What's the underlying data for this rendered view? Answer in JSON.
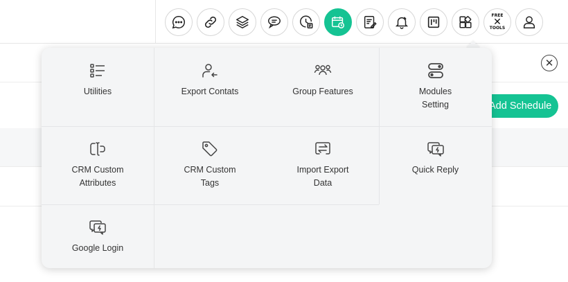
{
  "toolbar": {
    "icons": [
      "chat-icon",
      "link-icon",
      "layers-icon",
      "speech-bubble-icon",
      "clock-note-icon",
      "calendar-clock-icon",
      "note-edit-icon",
      "bell-icon",
      "kanban-icon",
      "widgets-icon",
      "free-tools-icon",
      "user-icon"
    ],
    "active": "calendar-clock-icon",
    "free_tools_top": "FREE",
    "free_tools_bottom": "TOOLS"
  },
  "page": {
    "add_schedule_label": "Add Schedule",
    "close_symbol": "✕"
  },
  "menu": {
    "items": [
      {
        "label": "Utilities",
        "icon": "list-icon"
      },
      {
        "label": "Export Contats",
        "icon": "user-export-icon"
      },
      {
        "label": "Group Features",
        "icon": "group-icon"
      },
      {
        "label": "Modules\nSetting",
        "icon": "toggle-icon"
      },
      {
        "label": "CRM Custom\nAttributes",
        "icon": "text-cursor-icon"
      },
      {
        "label": "CRM Custom\nTags",
        "icon": "tag-icon"
      },
      {
        "label": "Import Export\nData",
        "icon": "transfer-icon"
      },
      {
        "label": "Quick Reply",
        "icon": "quick-reply-icon"
      },
      {
        "label": "Google Login",
        "icon": "chat-lightning-icon"
      }
    ]
  },
  "colors": {
    "accent": "#15c393",
    "popover_bg": "#f4f5f6"
  }
}
